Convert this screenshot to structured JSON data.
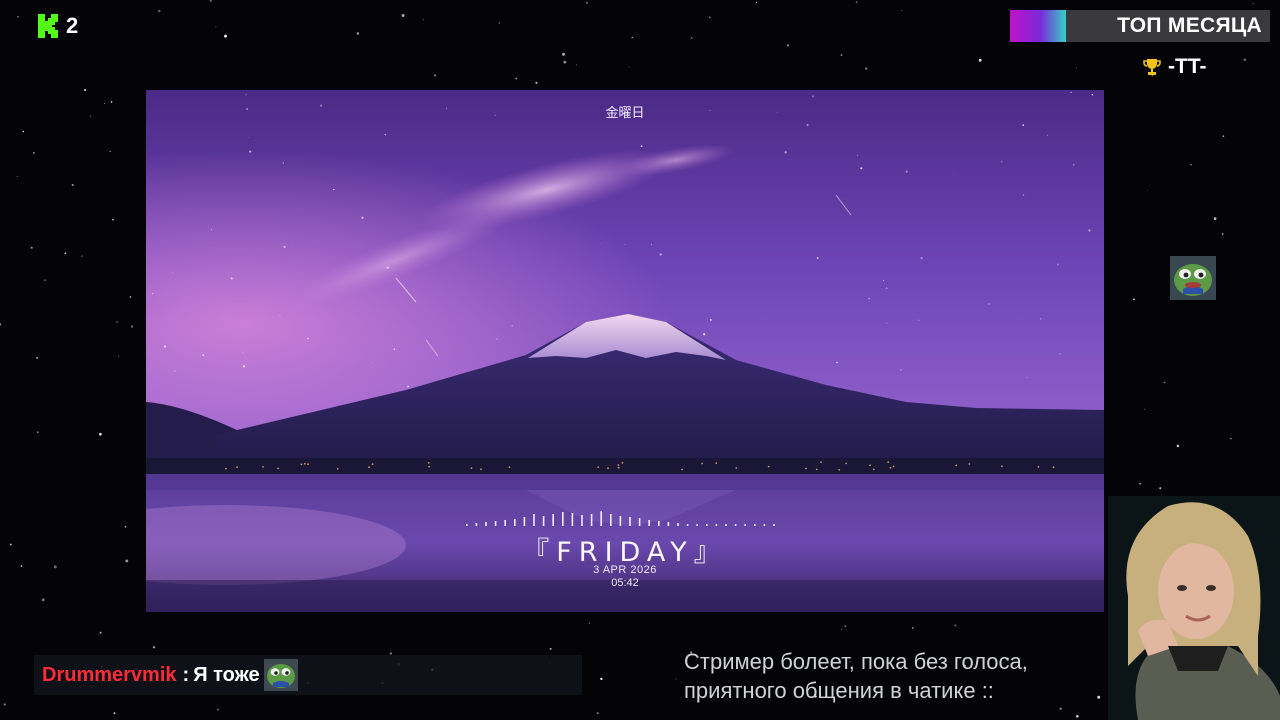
{
  "channel": {
    "viewer_count": "2",
    "logo_icon": "kick-logo-icon",
    "accent": "#53fc18"
  },
  "top_badge": {
    "label": "ТОП МЕСЯЦА",
    "user": "-TT-",
    "icon": "trophy-icon"
  },
  "screen": {
    "weekday_jp": "金曜日",
    "weekday": "『FRIDAY』",
    "date": "3 APR 2026",
    "time": "05:42"
  },
  "chat": {
    "username": "Drummervmik",
    "separator": ":",
    "message": "Я тоже",
    "emote": "pepe-emote"
  },
  "notice": {
    "line1": "Стример болеет, пока без голоса,",
    "line2": "приятного общения в чатике ::"
  },
  "colors": {
    "username": "#ff2a3a",
    "sky": "#6a3fb0",
    "badge_bg": "#3a3a3d"
  }
}
